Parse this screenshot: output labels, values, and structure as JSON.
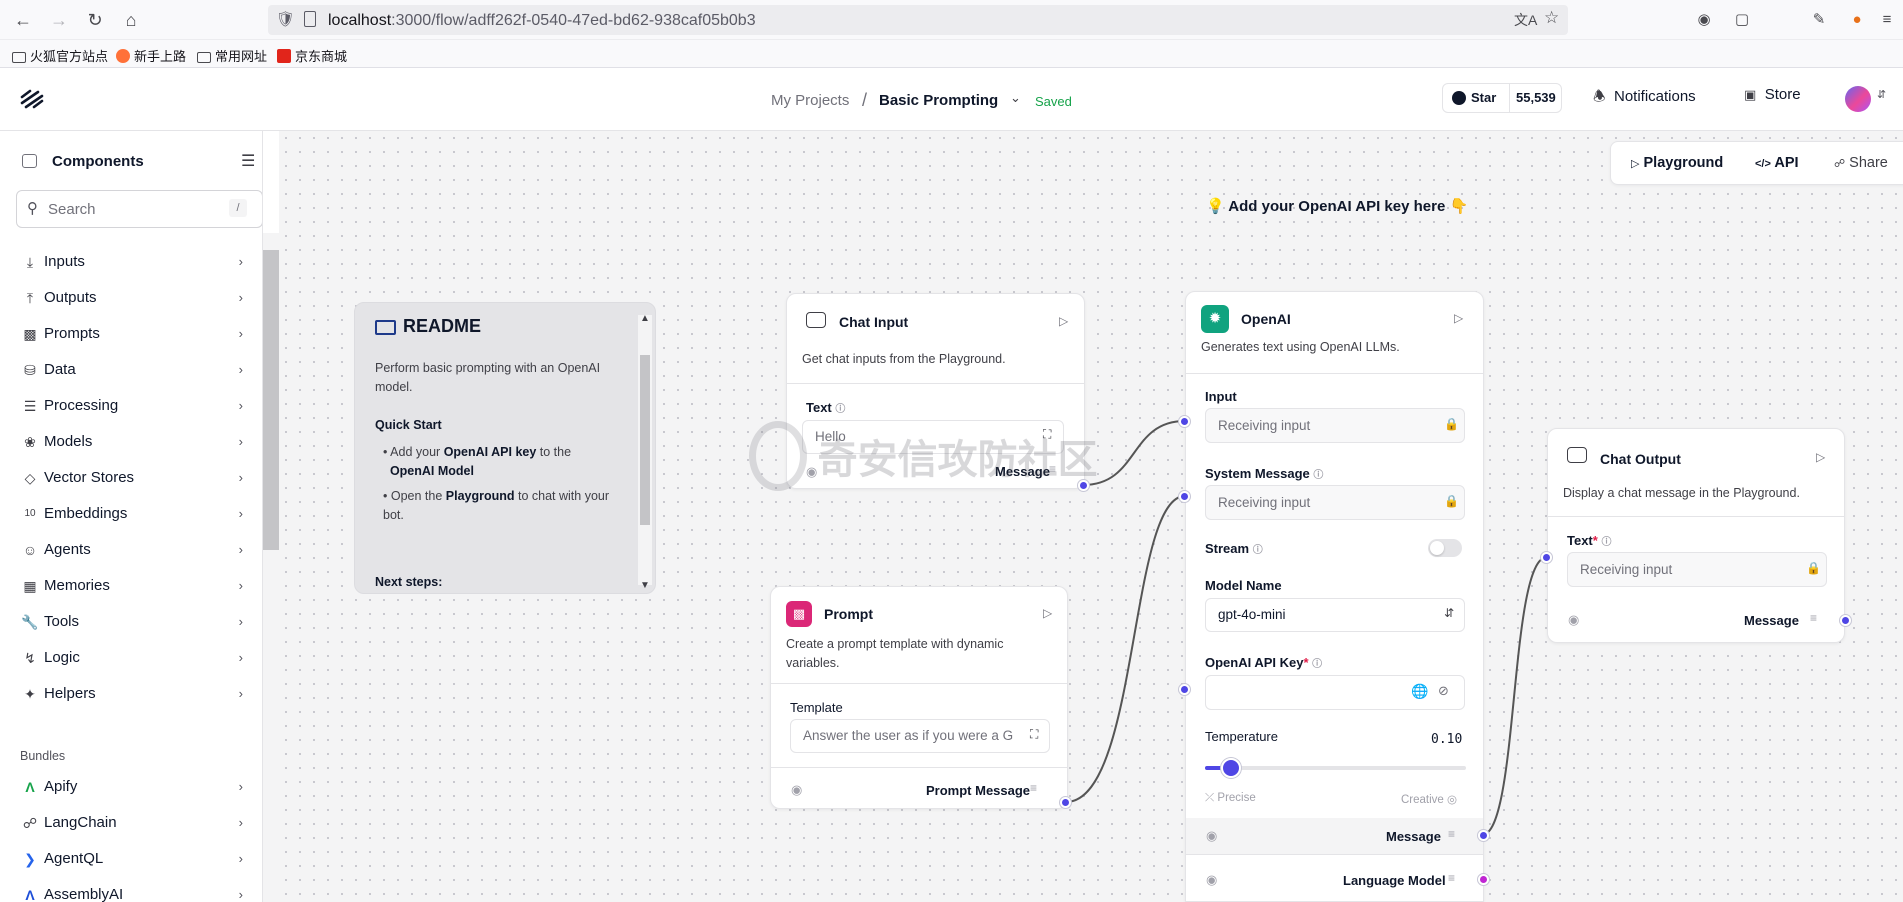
{
  "browser": {
    "url_host": "localhost",
    "url_rest": ":3000/flow/adff262f-0540-47ed-bd62-938caf05b0b3",
    "bookmarks": [
      "火狐官方站点",
      "新手上路",
      "常用网址",
      "京东商城"
    ]
  },
  "header": {
    "breadcrumb_projects": "My Projects",
    "breadcrumb_sep": "/",
    "flow_name": "Basic Prompting",
    "saved_status": "Saved",
    "github_star": "Star",
    "github_count": "55,539",
    "notifications": "Notifications",
    "store": "Store"
  },
  "toolbar": {
    "playground": "Playground",
    "api": "API",
    "share": "Share"
  },
  "sidebar": {
    "title": "Components",
    "search_placeholder": "Search",
    "search_shortcut": "/",
    "items": [
      {
        "label": "Inputs",
        "icon": "download-icon"
      },
      {
        "label": "Outputs",
        "icon": "upload-icon"
      },
      {
        "label": "Prompts",
        "icon": "terminal-icon"
      },
      {
        "label": "Data",
        "icon": "database-icon"
      },
      {
        "label": "Processing",
        "icon": "filter-icon"
      },
      {
        "label": "Models",
        "icon": "brain-icon"
      },
      {
        "label": "Vector Stores",
        "icon": "layers-icon"
      },
      {
        "label": "Embeddings",
        "icon": "binary-icon"
      },
      {
        "label": "Agents",
        "icon": "bot-icon"
      },
      {
        "label": "Memories",
        "icon": "cpu-icon"
      },
      {
        "label": "Tools",
        "icon": "wrench-icon"
      },
      {
        "label": "Logic",
        "icon": "git-branch-icon"
      },
      {
        "label": "Helpers",
        "icon": "wand-icon"
      }
    ],
    "bundles_title": "Bundles",
    "bundles": [
      {
        "label": "Apify"
      },
      {
        "label": "LangChain"
      },
      {
        "label": "AgentQL"
      },
      {
        "label": "AssemblyAI"
      }
    ]
  },
  "canvas": {
    "note": "💡 Add your OpenAI API key here 👇",
    "readme": {
      "title": "README",
      "intro": "Perform basic prompting with an OpenAI model.",
      "quick_start": "Quick Start",
      "step1_a": "Add your ",
      "step1_b": "OpenAI API key",
      "step1_c": " to the ",
      "step1_d": "OpenAI Model",
      "step2_a": "Open the ",
      "step2_b": "Playground",
      "step2_c": " to chat with your bot.",
      "next_steps": "Next steps:"
    },
    "chat_input": {
      "title": "Chat Input",
      "desc": "Get chat inputs from the Playground.",
      "text_label": "Text",
      "text_value": "Hello",
      "output": "Message"
    },
    "prompt": {
      "title": "Prompt",
      "desc": "Create a prompt template with dynamic variables.",
      "template_label": "Template",
      "template_value": "Answer the user as if you were a G",
      "output": "Prompt Message"
    },
    "openai": {
      "title": "OpenAI",
      "desc": "Generates text using OpenAI LLMs.",
      "input_label": "Input",
      "input_placeholder": "Receiving input",
      "system_label": "System Message",
      "system_placeholder": "Receiving input",
      "stream_label": "Stream",
      "model_label": "Model Name",
      "model_value": "gpt-4o-mini",
      "api_key_label": "OpenAI API Key",
      "temperature_label": "Temperature",
      "temperature_value": "0.10",
      "temperature": 0.1,
      "precise": "Precise",
      "creative": "Creative",
      "output_message": "Message",
      "output_model": "Language Model"
    },
    "chat_output": {
      "title": "Chat Output",
      "desc": "Display a chat message in the Playground.",
      "text_label": "Text",
      "text_placeholder": "Receiving input",
      "output": "Message"
    },
    "watermark": "奇安信攻防社区"
  },
  "colors": {
    "accent": "#4f46e5",
    "saved": "#16a34a",
    "required": "#e11d48",
    "openai": "#10a37f",
    "prompt": "#db2777"
  }
}
